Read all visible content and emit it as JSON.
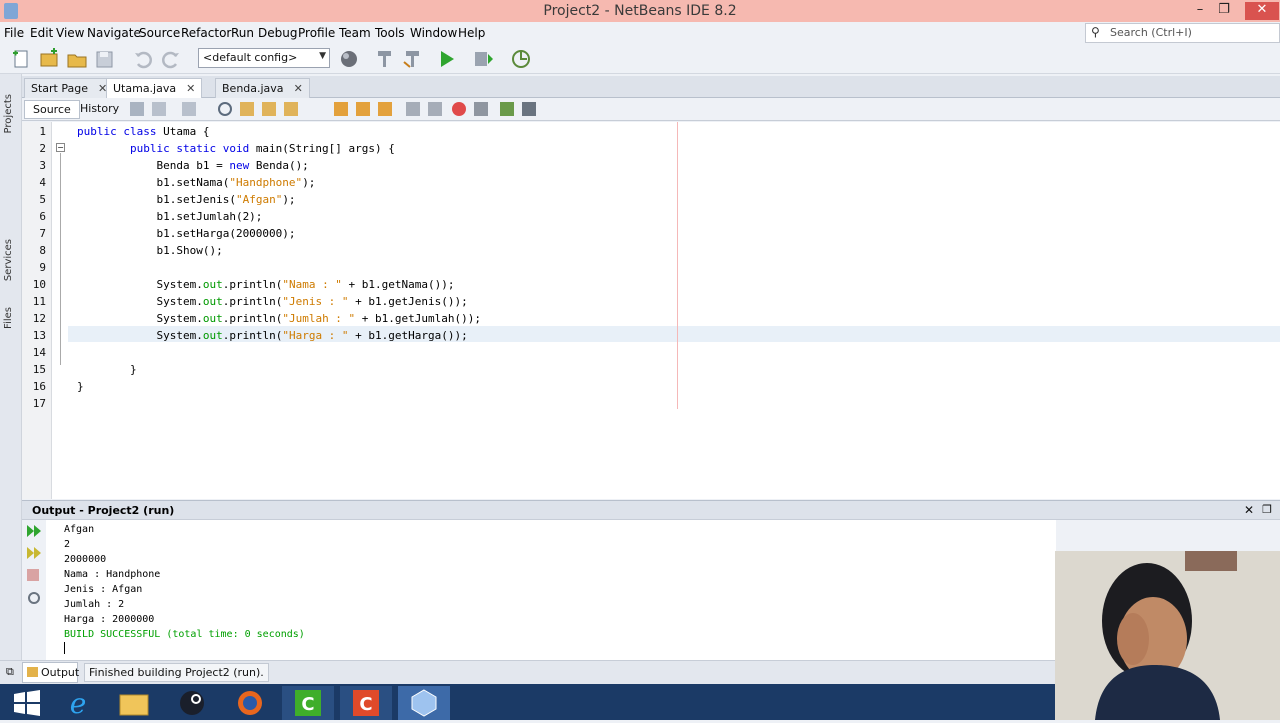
{
  "window": {
    "title": "Project2 - NetBeans IDE 8.2",
    "minimize": "–",
    "maximize": "❐",
    "close": "✕"
  },
  "menu": [
    "File",
    "Edit",
    "View",
    "Navigate",
    "Source",
    "Refactor",
    "Run",
    "Debug",
    "Profile",
    "Team",
    "Tools",
    "Window",
    "Help"
  ],
  "toolbar": {
    "config_value": "<default config>"
  },
  "search": {
    "placeholder": "Search (Ctrl+I)"
  },
  "side_panels": [
    "Projects",
    "Services",
    "Files"
  ],
  "tabs": [
    {
      "label": "Start Page",
      "active": false
    },
    {
      "label": "Utama.java",
      "active": true
    },
    {
      "label": "Benda.java",
      "active": false
    }
  ],
  "editor_toolbar": {
    "source_label": "Source",
    "history_label": "History"
  },
  "code": {
    "line_numbers": [
      "1",
      "2",
      "3",
      "4",
      "5",
      "6",
      "7",
      "8",
      "9",
      "10",
      "11",
      "12",
      "13",
      "14",
      "15",
      "16",
      "17"
    ],
    "lines": [
      [
        {
          "t": "public class ",
          "c": "kw"
        },
        {
          "t": "Utama {",
          "c": ""
        }
      ],
      [
        {
          "t": "        public static void ",
          "c": "kw"
        },
        {
          "t": "main(String[] args) {",
          "c": ""
        }
      ],
      [
        {
          "t": "            Benda b1 = ",
          "c": ""
        },
        {
          "t": "new ",
          "c": "kw"
        },
        {
          "t": "Benda();",
          "c": ""
        }
      ],
      [
        {
          "t": "            b1.setNama(",
          "c": ""
        },
        {
          "t": "\"Handphone\"",
          "c": "str"
        },
        {
          "t": ");",
          "c": ""
        }
      ],
      [
        {
          "t": "            b1.setJenis(",
          "c": ""
        },
        {
          "t": "\"Afgan\"",
          "c": "str"
        },
        {
          "t": ");",
          "c": ""
        }
      ],
      [
        {
          "t": "            b1.setJumlah(2);",
          "c": ""
        }
      ],
      [
        {
          "t": "            b1.setHarga(2000000);",
          "c": ""
        }
      ],
      [
        {
          "t": "            b1.Show();",
          "c": ""
        }
      ],
      [
        {
          "t": "",
          "c": ""
        }
      ],
      [
        {
          "t": "            System.",
          "c": ""
        },
        {
          "t": "out",
          "c": "fld"
        },
        {
          "t": ".println(",
          "c": ""
        },
        {
          "t": "\"Nama : \"",
          "c": "str"
        },
        {
          "t": " + b1.getNama());",
          "c": ""
        }
      ],
      [
        {
          "t": "            System.",
          "c": ""
        },
        {
          "t": "out",
          "c": "fld"
        },
        {
          "t": ".println(",
          "c": ""
        },
        {
          "t": "\"Jenis : \"",
          "c": "str"
        },
        {
          "t": " + b1.getJenis());",
          "c": ""
        }
      ],
      [
        {
          "t": "            System.",
          "c": ""
        },
        {
          "t": "out",
          "c": "fld"
        },
        {
          "t": ".println(",
          "c": ""
        },
        {
          "t": "\"Jumlah : \"",
          "c": "str"
        },
        {
          "t": " + b1.getJumlah());",
          "c": ""
        }
      ],
      [
        {
          "t": "            System.",
          "c": ""
        },
        {
          "t": "out",
          "c": "fld"
        },
        {
          "t": ".println(",
          "c": ""
        },
        {
          "t": "\"Harga : \"",
          "c": "str"
        },
        {
          "t": " + b1.getHarga());",
          "c": ""
        }
      ],
      [
        {
          "t": "",
          "c": ""
        }
      ],
      [
        {
          "t": "        }",
          "c": ""
        }
      ],
      [
        {
          "t": "}",
          "c": ""
        }
      ],
      [
        {
          "t": "",
          "c": ""
        }
      ]
    ]
  },
  "output": {
    "title": "Output - Project2 (run)",
    "lines": [
      "Afgan",
      "2",
      "2000000",
      "Nama : Handphone",
      "Jenis : Afgan",
      "Jumlah : 2",
      "Harga : 2000000"
    ],
    "build_message": "BUILD SUCCESSFUL (total time: 0 seconds)"
  },
  "statusbar": {
    "output_tab": "Output",
    "message": "Finished building Project2 (run)."
  },
  "colors": {
    "titlebar": "#f6b9b0",
    "keyword": "#0000e6",
    "string": "#ce7b00",
    "field": "#009900",
    "build_ok": "#00a000",
    "taskbar": "#1b3a66"
  }
}
